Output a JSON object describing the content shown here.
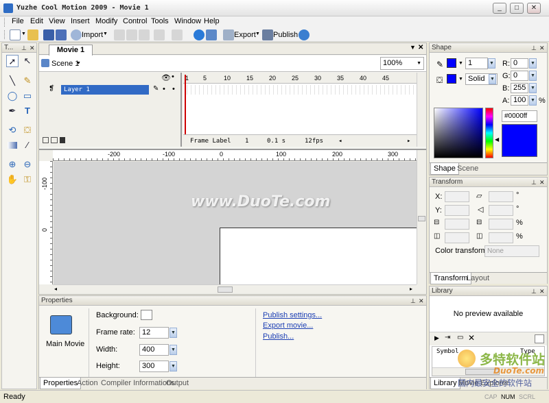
{
  "window": {
    "title": "Yuzhe Cool Motion 2009 - Movie 1",
    "controls": [
      "_",
      "□",
      "✕"
    ]
  },
  "menu": [
    "File",
    "Edit",
    "View",
    "Insert",
    "Modify",
    "Control",
    "Tools",
    "Window",
    "Help"
  ],
  "toolbar": {
    "import_label": "Import",
    "export_label": "Export",
    "publish_label": "Publish"
  },
  "tools_panel": {
    "title": "T..."
  },
  "document": {
    "tab": "Movie 1",
    "scene": "Scene 1",
    "zoom": "100%"
  },
  "timeline": {
    "frame_numbers": [
      "1",
      "5",
      "10",
      "15",
      "20",
      "25",
      "30",
      "35",
      "40",
      "45"
    ],
    "layer_name": "Layer 1",
    "status": {
      "frame_label": "Frame Label",
      "frame": "1",
      "time": "0.1 s",
      "fps": "12fps"
    }
  },
  "stage": {
    "ruler_h": [
      "-200",
      "-100",
      "0",
      "100",
      "200",
      "300"
    ],
    "ruler_v": [
      "-100",
      "0"
    ],
    "watermark": "www.DuoTe.com"
  },
  "properties": {
    "title": "Properties",
    "object_label": "Main Movie",
    "background_label": "Background:",
    "frame_rate_label": "Frame rate:",
    "frame_rate": "12",
    "width_label": "Width:",
    "width": "400",
    "height_label": "Height:",
    "height": "300",
    "links": [
      "Publish settings...",
      "Export movie...",
      "Publish..."
    ],
    "tabs": [
      "Properties",
      "Action",
      "Compiler Informations",
      "Output"
    ]
  },
  "shape_panel": {
    "title": "Shape",
    "stroke_width": "1",
    "fill_style": "Solid",
    "r_label": "R:",
    "r": "0",
    "g_label": "G:",
    "g": "0",
    "b_label": "B:",
    "b": "255",
    "a_label": "A:",
    "a": "100",
    "percent": "%",
    "hex": "#0000ff",
    "color": "#0000ff",
    "tabs": [
      "Shape",
      "Scene"
    ]
  },
  "transform_panel": {
    "title": "Transform",
    "x_label": "X:",
    "y_label": "Y:",
    "degree": "°",
    "percent": "%",
    "color_transform_label": "Color transform:",
    "color_transform_value": "None",
    "tabs": [
      "Transform",
      "Layout"
    ]
  },
  "library_panel": {
    "title": "Library",
    "preview": "No preview available",
    "columns": [
      "Symbol",
      "Type"
    ],
    "tabs": [
      "Library",
      "Movie Explorer"
    ]
  },
  "statusbar": {
    "text": "Ready",
    "indicators": [
      "CAP",
      "NUM",
      "SCRL"
    ]
  },
  "overlay_watermark": {
    "site": "多特软件站",
    "url": "DuoTe.com",
    "tagline": "国内最安全的软件站"
  }
}
